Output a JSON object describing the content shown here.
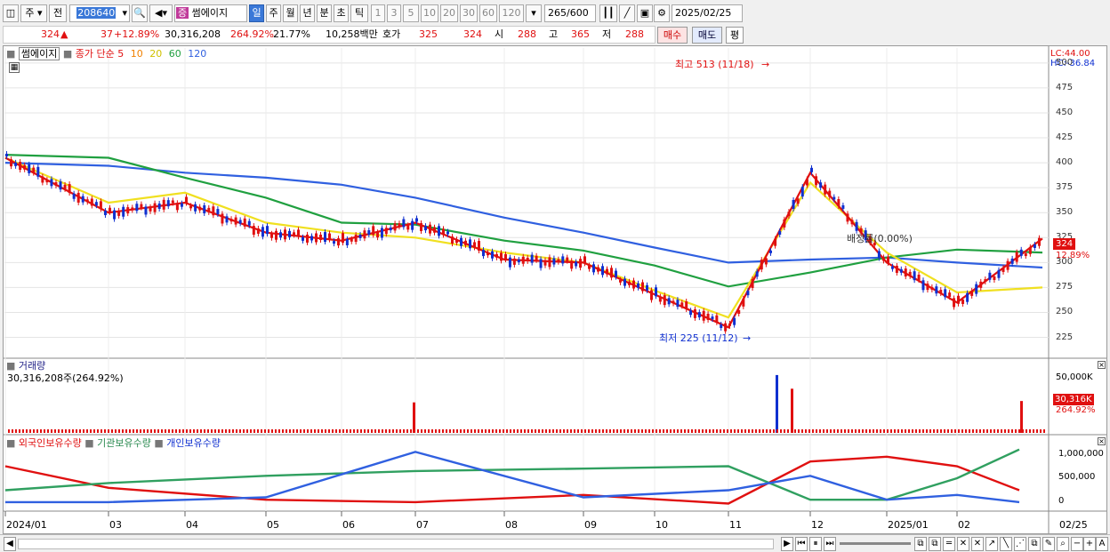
{
  "toolbar": {
    "market_select": "주",
    "prev_label": "전",
    "stock_code": "208640",
    "stock_badge": "증",
    "stock_name": "썸에이지",
    "period_tabs": [
      "일",
      "주",
      "월",
      "년",
      "분",
      "초",
      "틱"
    ],
    "minute_options": [
      "1",
      "3",
      "5",
      "10",
      "20",
      "30",
      "60",
      "120"
    ],
    "count_value": "265",
    "count_total": "/600",
    "date_value": "2025/02/25"
  },
  "quote": {
    "price": "324",
    "change": "37",
    "change_pct": "+12.89%",
    "volume": "30,316,208",
    "volume_ratio": "264.92%",
    "turnover": "21.77%",
    "amount": "10,258백만",
    "hoga_label": "호가",
    "hoga_ask": "325",
    "hoga_bid": "324",
    "open_label": "시",
    "open": "288",
    "high_label": "고",
    "high": "365",
    "low_label": "저",
    "low": "288",
    "buy_button": "매수",
    "sell_button": "매도",
    "eval_button": "평"
  },
  "price_panel": {
    "legend_name": "썸에이지",
    "legend_ma": "종가 단순",
    "ma_periods": [
      "5",
      "10",
      "20",
      "60",
      "120"
    ],
    "lc": "LC:44.00",
    "hc": "HC:-36.84",
    "y_ticks": [
      "500",
      "475",
      "450",
      "425",
      "400",
      "375",
      "350",
      "325",
      "300",
      "275",
      "250",
      "225"
    ],
    "current_price_tag": "324",
    "current_pct_tag": "12.89%",
    "high_annotation": "최고 513 (11/18)",
    "low_annotation": "최저 225 (11/12)",
    "allocation_annotation": "배정률(0.00%)"
  },
  "volume_panel": {
    "title": "거래량",
    "summary": "30,316,208주(264.92%)",
    "y_tick": "50,000K",
    "current_tag": "30,316K",
    "current_pct": "264.92%"
  },
  "holdings_panel": {
    "legend": [
      "외국인보유수량",
      "기관보유수량",
      "개인보유수량"
    ],
    "y_ticks": [
      "1,000,000",
      "500,000",
      "0"
    ]
  },
  "x_axis": {
    "labels": [
      "2024/01",
      "03",
      "04",
      "05",
      "06",
      "07",
      "08",
      "09",
      "10",
      "11",
      "12",
      "2025/01",
      "02"
    ],
    "end_label": "02/25"
  },
  "colors": {
    "up": "#e01010",
    "down": "#1030d0",
    "ma5": "#e01010",
    "ma10": "#f08000",
    "ma20": "#f0e020",
    "ma60": "#20a040",
    "ma120": "#3060e0",
    "foreign": "#e01010",
    "institution": "#30a060",
    "individual": "#3060e0"
  },
  "chart_data": [
    {
      "type": "line",
      "title": "썸에이지",
      "series": [
        {
          "name": "120",
          "x": [
            "2024/01",
            "03",
            "04",
            "05",
            "06",
            "07",
            "08",
            "09",
            "10",
            "11",
            "12",
            "2025/01",
            "02",
            "02/25"
          ],
          "values": [
            400,
            397,
            390,
            385,
            378,
            365,
            345,
            330,
            315,
            300,
            303,
            305,
            300,
            295
          ]
        },
        {
          "name": "60",
          "x": [
            "2024/01",
            "03",
            "04",
            "05",
            "06",
            "07",
            "08",
            "09",
            "10",
            "11",
            "12",
            "2025/01",
            "02",
            "02/25"
          ],
          "values": [
            408,
            405,
            385,
            365,
            340,
            338,
            322,
            312,
            297,
            276,
            290,
            305,
            313,
            310
          ]
        },
        {
          "name": "20",
          "x": [
            "2024/01",
            "03",
            "04",
            "05",
            "06",
            "07",
            "08",
            "09",
            "10",
            "11",
            "12",
            "2025/01",
            "02",
            "02/25"
          ],
          "values": [
            405,
            360,
            370,
            340,
            330,
            325,
            310,
            300,
            272,
            245,
            380,
            310,
            270,
            275
          ]
        },
        {
          "name": "5",
          "x": [
            "2024/01",
            "03",
            "04",
            "05",
            "06",
            "07",
            "08",
            "09",
            "10",
            "11",
            "12",
            "2025/01",
            "02",
            "02/25"
          ],
          "values": [
            405,
            350,
            360,
            330,
            322,
            340,
            303,
            300,
            268,
            235,
            390,
            300,
            260,
            324
          ]
        }
      ],
      "annotations": [
        "최고 513 (11/18)",
        "최저 225 (11/12)"
      ],
      "ylim": [
        205,
        515
      ]
    },
    {
      "type": "bar",
      "title": "거래량",
      "categories": [
        "07",
        "11",
        "12",
        "02/25"
      ],
      "values": [
        29000,
        55000,
        42000,
        30316
      ],
      "ylim": [
        0,
        60000
      ]
    },
    {
      "type": "line",
      "series": [
        {
          "name": "외국인보유수량",
          "x": [
            "2024/01",
            "03",
            "05",
            "07",
            "09",
            "11",
            "12",
            "2025/01",
            "02",
            "02/25"
          ],
          "values": [
            800000,
            350000,
            100000,
            50000,
            200000,
            20000,
            900000,
            1000000,
            800000,
            300000
          ]
        },
        {
          "name": "기관보유수량",
          "x": [
            "2024/01",
            "03",
            "05",
            "07",
            "09",
            "11",
            "12",
            "2025/01",
            "02",
            "02/25"
          ],
          "values": [
            300000,
            450000,
            600000,
            700000,
            750000,
            800000,
            100000,
            100000,
            550000,
            1150000
          ]
        },
        {
          "name": "개인보유수량",
          "x": [
            "2024/01",
            "03",
            "05",
            "07",
            "09",
            "11",
            "12",
            "2025/01",
            "02",
            "02/25"
          ],
          "values": [
            50000,
            50000,
            150000,
            1100000,
            150000,
            300000,
            600000,
            100000,
            200000,
            50000
          ]
        }
      ],
      "ylim": [
        -100000,
        1200000
      ]
    }
  ]
}
